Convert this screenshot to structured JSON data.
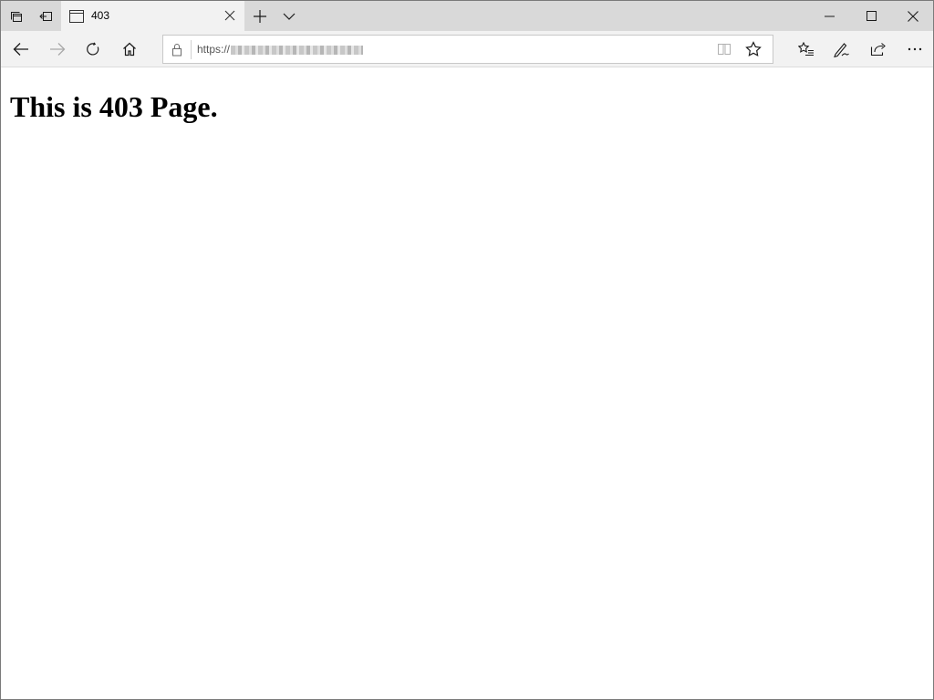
{
  "browser": {
    "tab": {
      "title": "403"
    },
    "address_bar": {
      "url_prefix": "https://"
    }
  },
  "page": {
    "heading": "This is 403 Page."
  }
}
